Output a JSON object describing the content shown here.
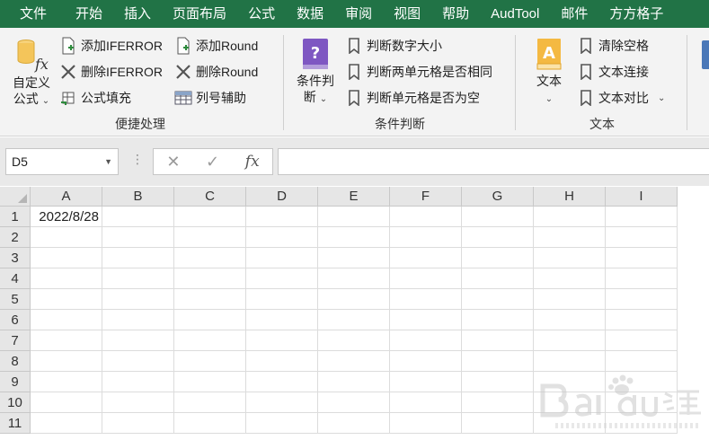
{
  "tabs": [
    "文件",
    "开始",
    "插入",
    "页面布局",
    "公式",
    "数据",
    "审阅",
    "视图",
    "帮助",
    "AudTool",
    "邮件",
    "方方格子"
  ],
  "ribbon": {
    "group1": {
      "label": "便捷处理",
      "custom_formula_line1": "自定义",
      "custom_formula_line2": "公式",
      "add_iferror": "添加IFERROR",
      "del_iferror": "删除IFERROR",
      "formula_fill": "公式填充",
      "add_round": "添加Round",
      "del_round": "删除Round",
      "col_helper": "列号辅助"
    },
    "group2": {
      "label": "条件判断",
      "cond_line1": "条件判",
      "cond_line2": "断",
      "judge_num": "判断数字大小",
      "judge_two": "判断两单元格是否相同",
      "judge_empty": "判断单元格是否为空"
    },
    "group3": {
      "label": "文本",
      "text_btn": "文本",
      "clear_space": "清除空格",
      "text_concat": "文本连接",
      "text_compare": "文本对比"
    }
  },
  "formula_bar": {
    "name_box": "D5",
    "fx_label": "fx",
    "formula": ""
  },
  "sheet": {
    "columns": [
      "A",
      "B",
      "C",
      "D",
      "E",
      "F",
      "G",
      "H",
      "I"
    ],
    "rows": [
      "1",
      "2",
      "3",
      "4",
      "5",
      "6",
      "7",
      "8",
      "9",
      "10",
      "11"
    ],
    "a1": "2022/8/28"
  },
  "colors": {
    "ribbon_green": "#217346",
    "purple_icon": "#7e57c2",
    "book_orange": "#f4b942"
  }
}
